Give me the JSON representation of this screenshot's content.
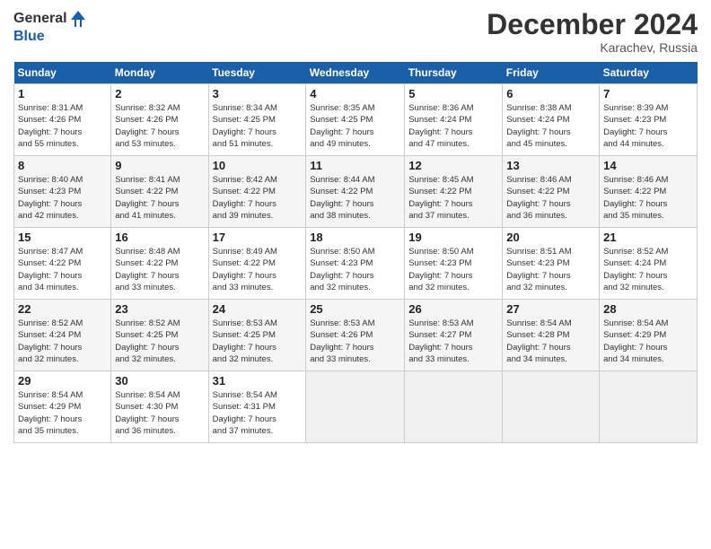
{
  "header": {
    "logo_line1": "General",
    "logo_line2": "Blue",
    "month": "December 2024",
    "location": "Karachev, Russia"
  },
  "weekdays": [
    "Sunday",
    "Monday",
    "Tuesday",
    "Wednesday",
    "Thursday",
    "Friday",
    "Saturday"
  ],
  "weeks": [
    [
      {
        "day": "1",
        "info": "Sunrise: 8:31 AM\nSunset: 4:26 PM\nDaylight: 7 hours\nand 55 minutes."
      },
      {
        "day": "2",
        "info": "Sunrise: 8:32 AM\nSunset: 4:26 PM\nDaylight: 7 hours\nand 53 minutes."
      },
      {
        "day": "3",
        "info": "Sunrise: 8:34 AM\nSunset: 4:25 PM\nDaylight: 7 hours\nand 51 minutes."
      },
      {
        "day": "4",
        "info": "Sunrise: 8:35 AM\nSunset: 4:25 PM\nDaylight: 7 hours\nand 49 minutes."
      },
      {
        "day": "5",
        "info": "Sunrise: 8:36 AM\nSunset: 4:24 PM\nDaylight: 7 hours\nand 47 minutes."
      },
      {
        "day": "6",
        "info": "Sunrise: 8:38 AM\nSunset: 4:24 PM\nDaylight: 7 hours\nand 45 minutes."
      },
      {
        "day": "7",
        "info": "Sunrise: 8:39 AM\nSunset: 4:23 PM\nDaylight: 7 hours\nand 44 minutes."
      }
    ],
    [
      {
        "day": "8",
        "info": "Sunrise: 8:40 AM\nSunset: 4:23 PM\nDaylight: 7 hours\nand 42 minutes."
      },
      {
        "day": "9",
        "info": "Sunrise: 8:41 AM\nSunset: 4:22 PM\nDaylight: 7 hours\nand 41 minutes."
      },
      {
        "day": "10",
        "info": "Sunrise: 8:42 AM\nSunset: 4:22 PM\nDaylight: 7 hours\nand 39 minutes."
      },
      {
        "day": "11",
        "info": "Sunrise: 8:44 AM\nSunset: 4:22 PM\nDaylight: 7 hours\nand 38 minutes."
      },
      {
        "day": "12",
        "info": "Sunrise: 8:45 AM\nSunset: 4:22 PM\nDaylight: 7 hours\nand 37 minutes."
      },
      {
        "day": "13",
        "info": "Sunrise: 8:46 AM\nSunset: 4:22 PM\nDaylight: 7 hours\nand 36 minutes."
      },
      {
        "day": "14",
        "info": "Sunrise: 8:46 AM\nSunset: 4:22 PM\nDaylight: 7 hours\nand 35 minutes."
      }
    ],
    [
      {
        "day": "15",
        "info": "Sunrise: 8:47 AM\nSunset: 4:22 PM\nDaylight: 7 hours\nand 34 minutes."
      },
      {
        "day": "16",
        "info": "Sunrise: 8:48 AM\nSunset: 4:22 PM\nDaylight: 7 hours\nand 33 minutes."
      },
      {
        "day": "17",
        "info": "Sunrise: 8:49 AM\nSunset: 4:22 PM\nDaylight: 7 hours\nand 33 minutes."
      },
      {
        "day": "18",
        "info": "Sunrise: 8:50 AM\nSunset: 4:23 PM\nDaylight: 7 hours\nand 32 minutes."
      },
      {
        "day": "19",
        "info": "Sunrise: 8:50 AM\nSunset: 4:23 PM\nDaylight: 7 hours\nand 32 minutes."
      },
      {
        "day": "20",
        "info": "Sunrise: 8:51 AM\nSunset: 4:23 PM\nDaylight: 7 hours\nand 32 minutes."
      },
      {
        "day": "21",
        "info": "Sunrise: 8:52 AM\nSunset: 4:24 PM\nDaylight: 7 hours\nand 32 minutes."
      }
    ],
    [
      {
        "day": "22",
        "info": "Sunrise: 8:52 AM\nSunset: 4:24 PM\nDaylight: 7 hours\nand 32 minutes."
      },
      {
        "day": "23",
        "info": "Sunrise: 8:52 AM\nSunset: 4:25 PM\nDaylight: 7 hours\nand 32 minutes."
      },
      {
        "day": "24",
        "info": "Sunrise: 8:53 AM\nSunset: 4:25 PM\nDaylight: 7 hours\nand 32 minutes."
      },
      {
        "day": "25",
        "info": "Sunrise: 8:53 AM\nSunset: 4:26 PM\nDaylight: 7 hours\nand 33 minutes."
      },
      {
        "day": "26",
        "info": "Sunrise: 8:53 AM\nSunset: 4:27 PM\nDaylight: 7 hours\nand 33 minutes."
      },
      {
        "day": "27",
        "info": "Sunrise: 8:54 AM\nSunset: 4:28 PM\nDaylight: 7 hours\nand 34 minutes."
      },
      {
        "day": "28",
        "info": "Sunrise: 8:54 AM\nSunset: 4:29 PM\nDaylight: 7 hours\nand 34 minutes."
      }
    ],
    [
      {
        "day": "29",
        "info": "Sunrise: 8:54 AM\nSunset: 4:29 PM\nDaylight: 7 hours\nand 35 minutes."
      },
      {
        "day": "30",
        "info": "Sunrise: 8:54 AM\nSunset: 4:30 PM\nDaylight: 7 hours\nand 36 minutes."
      },
      {
        "day": "31",
        "info": "Sunrise: 8:54 AM\nSunset: 4:31 PM\nDaylight: 7 hours\nand 37 minutes."
      },
      null,
      null,
      null,
      null
    ]
  ]
}
